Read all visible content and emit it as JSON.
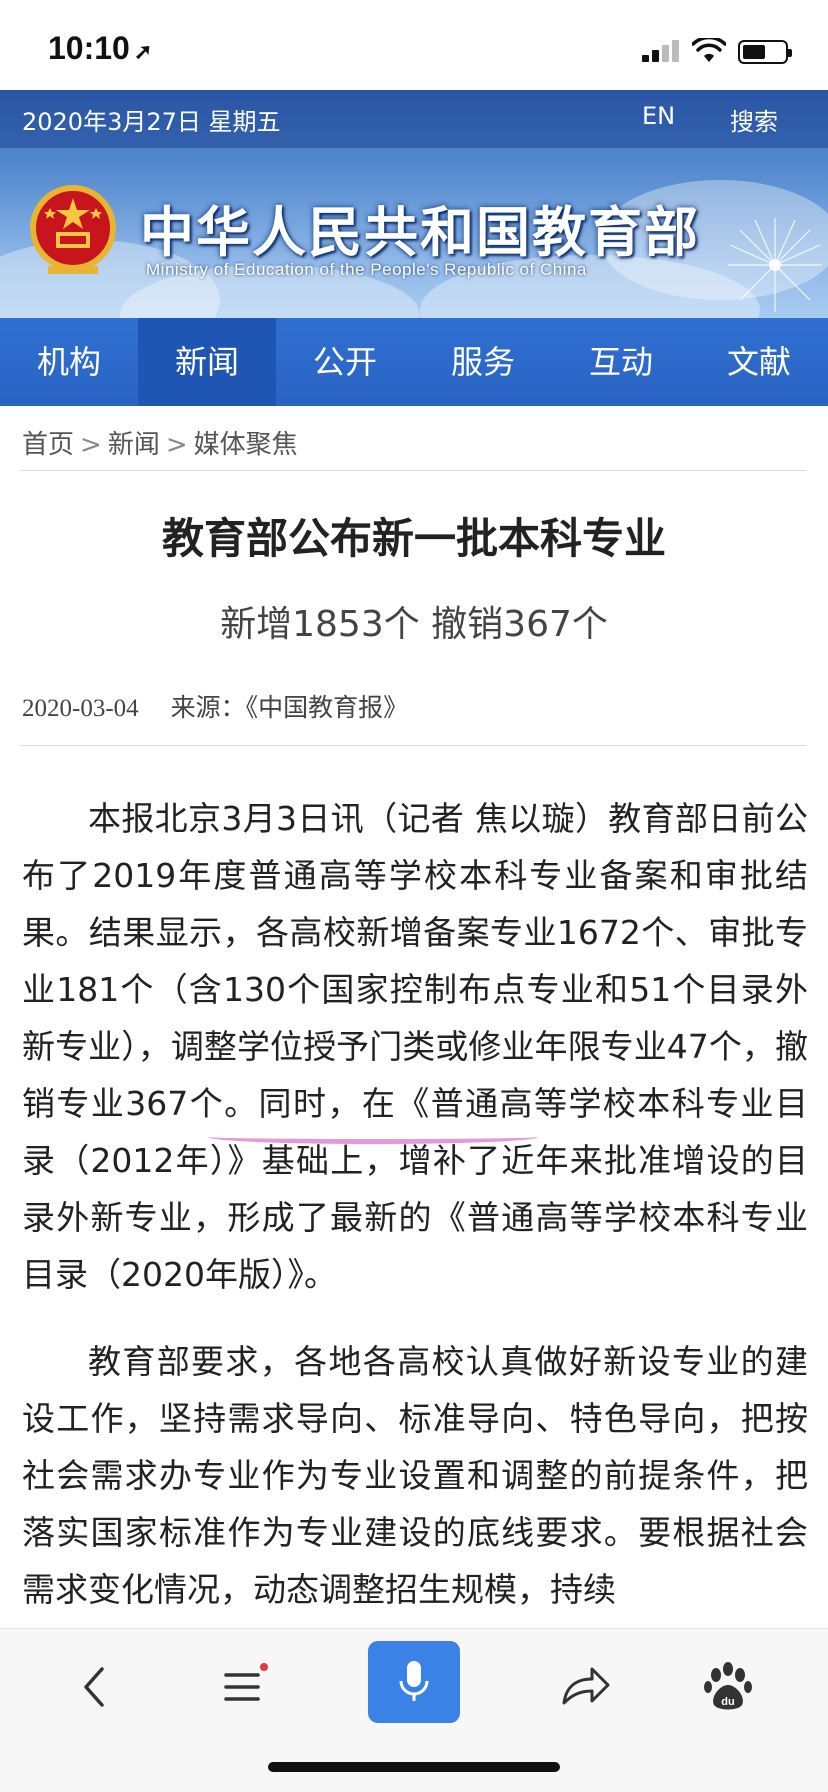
{
  "status_bar": {
    "time": "10:10",
    "location_icon": "location-arrow-icon",
    "signal_icon": "cellular-signal-icon",
    "wifi_icon": "wifi-icon",
    "battery_icon": "battery-icon"
  },
  "site": {
    "date": "2020年3月27日 星期五",
    "lang_label": "EN",
    "search_label": "搜索",
    "title": "中华人民共和国教育部",
    "subtitle": "Ministry of Education of the People's Republic of China",
    "emblem_icon": "national-emblem-icon"
  },
  "nav": {
    "items": [
      {
        "label": "机构"
      },
      {
        "label": "新闻"
      },
      {
        "label": "公开"
      },
      {
        "label": "服务"
      },
      {
        "label": "互动"
      },
      {
        "label": "文献"
      }
    ],
    "active": "新闻"
  },
  "breadcrumb": {
    "items": [
      "首页",
      "新闻",
      "媒体聚焦"
    ],
    "separator": ">"
  },
  "article": {
    "title": "教育部公布新一批本科专业",
    "subtitle": "新增1853个 撤销367个",
    "date": "2020-03-04",
    "source": "来源：《中国教育报》",
    "paragraphs": [
      "本报北京3月3日讯（记者 焦以璇）教育部日前公布了2019年度普通高等学校本科专业备案和审批结果。结果显示，各高校新增备案专业1672个、审批专业181个（含130个国家控制布点专业和51个目录外新专业），调整学位授予门类或修业年限专业47个，撤销专业367个。同时，在《普通高等学校本科专业目录（2012年）》基础上，增补了近年来批准增设的目录外新专业，形成了最新的《普通高等学校本科专业目录（2020年版）》。",
      "教育部要求，各地各高校认真做好新设专业的建设工作，坚持需求导向、标准导向、特色导向，把按社会需求办专业作为专业设置和调整的前提条件，把落实国家标准作为专业建设的底线要求。要根据社会需求变化情况，动态调整招生规模，持续"
    ]
  },
  "toolbar": {
    "back_icon": "back-chevron-icon",
    "menu_icon": "menu-icon",
    "mic_icon": "microphone-icon",
    "share_icon": "share-icon",
    "baidu_icon": "baidu-paw-icon"
  },
  "colors": {
    "nav_bg": "#2a64c4",
    "nav_active": "#1f56b3",
    "mic_button": "#3b82e6",
    "highlight_underline": "#dc78c8"
  }
}
